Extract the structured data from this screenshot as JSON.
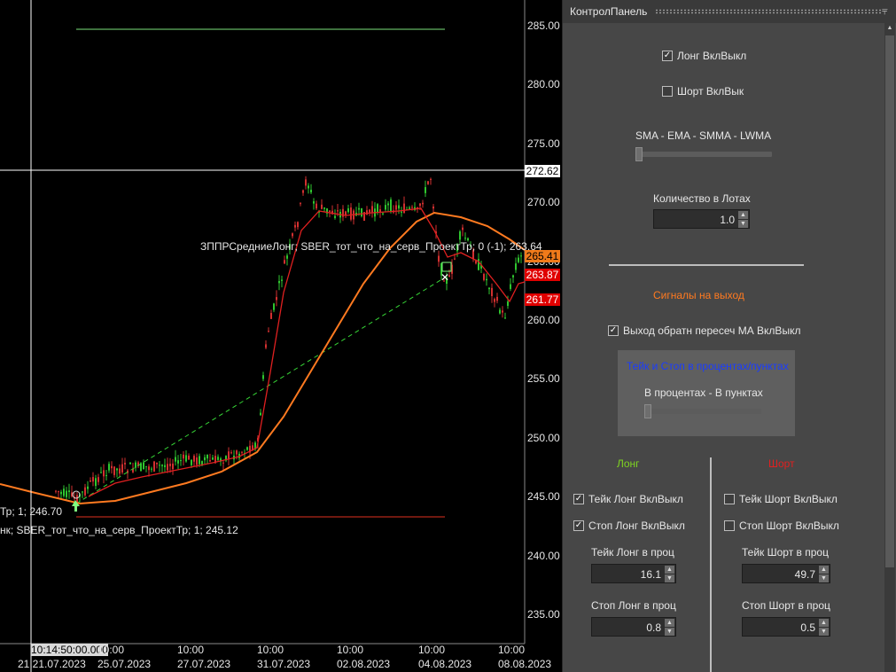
{
  "chart": {
    "price_ticks": [
      "285.00",
      "280.00",
      "275.00",
      "270.00",
      "265.00",
      "260.00",
      "255.00",
      "250.00",
      "245.00",
      "240.00",
      "235.00"
    ],
    "time_labels": [
      {
        "time": "10:14:50:00.000",
        "date": "21.21.07.2023"
      },
      {
        "time": "10:00",
        "date": "25.07.2023"
      },
      {
        "time": "10:00",
        "date": "27.07.2023"
      },
      {
        "time": "10:00",
        "date": "31.07.2023"
      },
      {
        "time": "10:00",
        "date": "02.08.2023"
      },
      {
        "time": "10:00",
        "date": "04.08.2023"
      },
      {
        "time": "10:00",
        "date": "08.08.2023"
      }
    ],
    "crosshair_price": "272.62",
    "price_tags": [
      {
        "value": "265.41",
        "color": "#f07a1a"
      },
      {
        "value": "263.87",
        "color": "#e00000"
      },
      {
        "value": "261.77",
        "color": "#e00000"
      }
    ],
    "annotations": {
      "short_entry": "ЗППРСредниеЛонг; SBER_тот_что_на_серв_ПроектТр; 0 (-1); 263.64",
      "long_entry": "Тр; 1; 246.70",
      "long_exit": "нк; SBER_тот_что_на_серв_ПроектТр; 1; 245.12"
    },
    "colors": {
      "up": "#2fc62f",
      "down": "#d23030",
      "ma_fast": "#e02020",
      "ma_slow": "#ff7a20",
      "trend": "#30d030"
    }
  },
  "panel": {
    "title": "КонтролПанель",
    "pin_icon": "⫧",
    "long_toggle": {
      "label": "Лонг ВклВыкл",
      "checked": true
    },
    "short_toggle": {
      "label": "Шорт ВклВык",
      "checked": false
    },
    "ma_type_label": "SMA - EMA - SMMA - LWMA",
    "lots_label": "Количество в Лотах",
    "lots_value": "1.0",
    "signals_label": "Сигналы на выход",
    "signals_color": "#ff7a20",
    "exit_cross": {
      "label": "Выход обратн пересеч МА ВклВыкл",
      "checked": true
    },
    "tp_sl_header": "Тейк и Стоп в процентах/пунктах",
    "tp_sl_header_color": "#1a3cff",
    "units_label": "В процентах - В пунктах",
    "long_header": "Лонг",
    "long_color": "#7ed321",
    "short_header": "Шорт",
    "short_color": "#e02020",
    "take_long": {
      "label": "Тейк Лонг ВклВыкл",
      "checked": true
    },
    "stop_long": {
      "label": "Стоп Лонг ВклВыкл",
      "checked": true
    },
    "take_short": {
      "label": "Тейк Шорт ВклВыкл",
      "checked": false
    },
    "stop_short": {
      "label": "Стоп Шорт ВклВыкл",
      "checked": false
    },
    "take_long_pct_label": "Тейк Лонг в проц",
    "take_long_pct": "16.1",
    "take_short_pct_label": "Тейк Шорт в проц",
    "take_short_pct": "49.7",
    "stop_long_pct_label": "Стоп Лонг в проц",
    "stop_long_pct": "0.8",
    "stop_short_pct_label": "Стоп Шорт в проц",
    "stop_short_pct": "0.5"
  }
}
